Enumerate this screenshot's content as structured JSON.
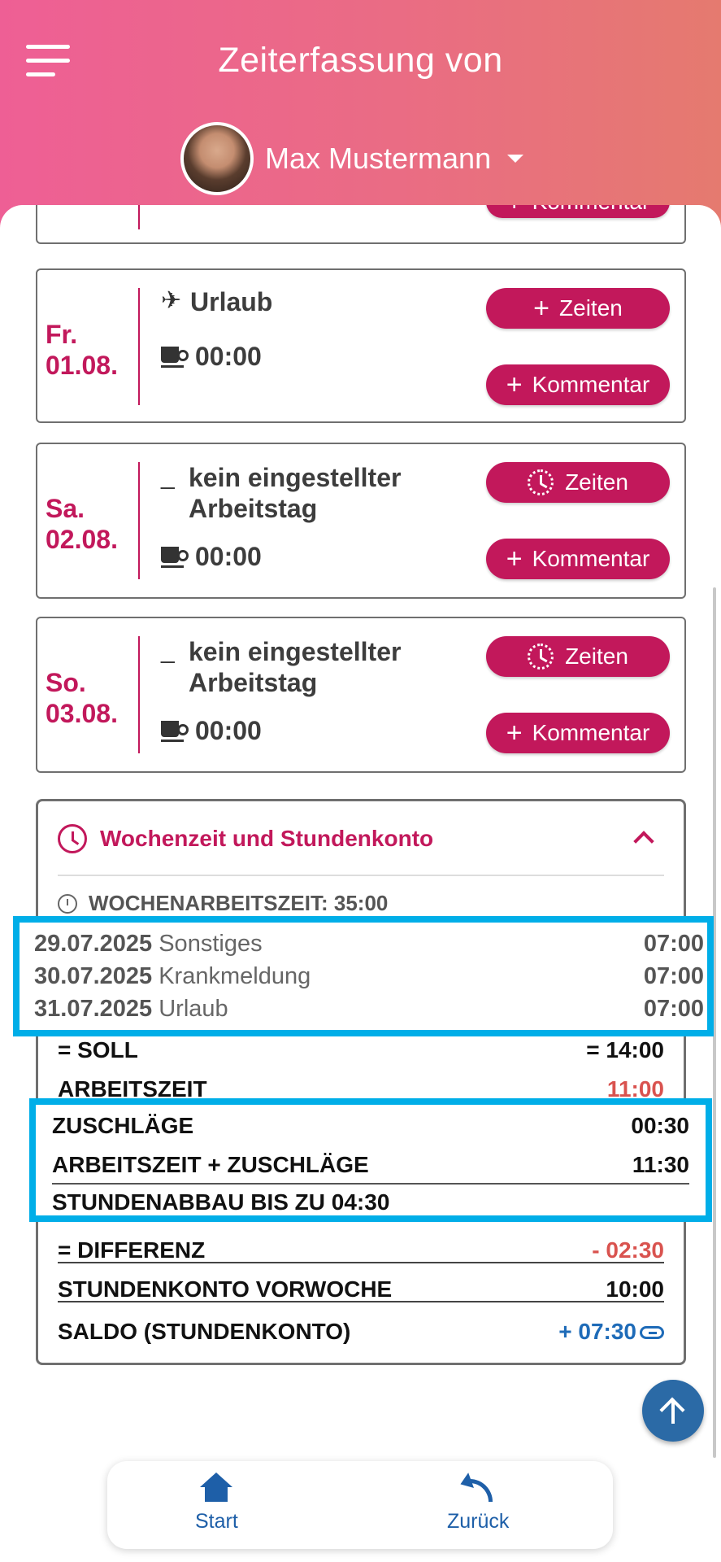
{
  "header": {
    "title": "Zeiterfassung von",
    "user_name": "Max Mustermann"
  },
  "partial_card": {
    "comment_label": "Kommentar"
  },
  "days": [
    {
      "weekday": "Fr.",
      "date": "01.08.",
      "status": "Urlaub",
      "status_icon": "vacation-plane-icon",
      "pause": "00:00",
      "times_label": "Zeiten",
      "comment_label": "Kommentar"
    },
    {
      "weekday": "Sa.",
      "date": "02.08.",
      "status_line1": "kein eingestellter",
      "status_line2": "Arbeitstag",
      "pause": "00:00",
      "times_label": "Zeiten",
      "comment_label": "Kommentar"
    },
    {
      "weekday": "So.",
      "date": "03.08.",
      "status_line1": "kein eingestellter",
      "status_line2": "Arbeitstag",
      "pause": "00:00",
      "times_label": "Zeiten",
      "comment_label": "Kommentar"
    }
  ],
  "summary": {
    "title": "Wochenzeit und Stundenkonto",
    "week_hours": "WOCHENARBEITSZEIT: 35:00",
    "absences": [
      {
        "date": "29.07.2025",
        "type": "Sonstiges",
        "value": "07:00"
      },
      {
        "date": "30.07.2025",
        "type": "Krankmeldung",
        "value": "07:00"
      },
      {
        "date": "31.07.2025",
        "type": "Urlaub",
        "value": "07:00"
      }
    ],
    "soll_label": "= SOLL",
    "soll_value": "= 14:00",
    "arbeitszeit_label": "ARBEITSZEIT",
    "arbeitszeit_value": "11:00",
    "zuschlaege_label": "ZUSCHLÄGE",
    "zuschlaege_value": "00:30",
    "az_plus_label": "ARBEITSZEIT + ZUSCHLÄGE",
    "az_plus_value": "11:30",
    "abbau_label": "STUNDENABBAU BIS ZU 04:30",
    "differenz_label": "= DIFFERENZ",
    "differenz_value": "- 02:30",
    "vorwoche_label": "STUNDENKONTO VORWOCHE",
    "vorwoche_value": "10:00",
    "saldo_label": "SALDO (STUNDENKONTO)",
    "saldo_value": "+ 07:30"
  },
  "nav": {
    "start_label": "Start",
    "back_label": "Zurück"
  },
  "colors": {
    "accent": "#c2185b",
    "header_gradient_start": "#ee5f95",
    "header_gradient_end": "#e57a6f",
    "blue": "#1e5fa8",
    "highlight": "#00aee8",
    "negative": "#d9534f"
  }
}
